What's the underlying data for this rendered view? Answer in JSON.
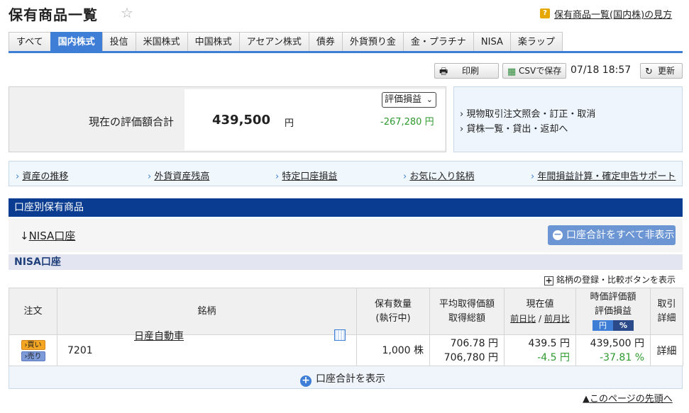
{
  "header": {
    "title": "保有商品一覧",
    "help_icon": "?",
    "help_link": "保有商品一覧(国内株)の見方"
  },
  "tabs": [
    {
      "label": "すべて"
    },
    {
      "label": "国内株式",
      "active": true
    },
    {
      "label": "投信"
    },
    {
      "label": "米国株式"
    },
    {
      "label": "中国株式"
    },
    {
      "label": "アセアン株式"
    },
    {
      "label": "債券"
    },
    {
      "label": "外貨預り金"
    },
    {
      "label": "金・プラチナ"
    },
    {
      "label": "NISA"
    },
    {
      "label": "楽ラップ"
    }
  ],
  "toolbar": {
    "print_label": "印刷",
    "csv_label": "CSVで保存",
    "timestamp": "07/18 18:57",
    "refresh_label": "更新"
  },
  "summary": {
    "label": "現在の評価額合計",
    "value": "439,500",
    "unit": "円",
    "select_value": "評価損益",
    "profit_loss": "-267,280 円"
  },
  "quick_links": [
    "現物取引注文照会・訂正・取消",
    "貸株一覧・貸出・返却へ"
  ],
  "nav_links": [
    "資産の推移",
    "外貨資産残高",
    "特定口座損益",
    "お気に入り銘柄",
    "年間損益計算・確定申告サポート"
  ],
  "section": {
    "title": "口座別保有商品",
    "account_link": "NISA口座",
    "hide_button": "口座合計をすべて非表示",
    "nisa_header": "NISA口座",
    "compare_link": "銘柄の登録・比較ボタンを表示"
  },
  "table": {
    "headers": {
      "order": "注文",
      "name": "銘柄",
      "qty_1": "保有数量",
      "qty_2": "(執行中)",
      "avg_1": "平均取得価額",
      "avg_2": "取得総額",
      "cur_1": "現在値",
      "cur_prev_day": "前日比",
      "cur_sep": " / ",
      "cur_prev_month": "前月比",
      "val_1": "時価評価額",
      "val_2": "評価損益",
      "toggle_yen": "円",
      "toggle_pct": "%",
      "detail_1": "取引",
      "detail_2": "詳細"
    },
    "row": {
      "buy": "買い",
      "sell": "売り",
      "code": "7201",
      "name": "日産自動車",
      "qty": "1,000 株",
      "avg_price": "706.78 円",
      "total_cost": "706,780 円",
      "price": "439.5 円",
      "change": "-4.5 円",
      "market_value": "439,500 円",
      "pl": "-37.81 %",
      "detail": "詳細"
    }
  },
  "footer": {
    "show_total": "口座合計を表示",
    "to_top": "このページの先頭へ"
  }
}
